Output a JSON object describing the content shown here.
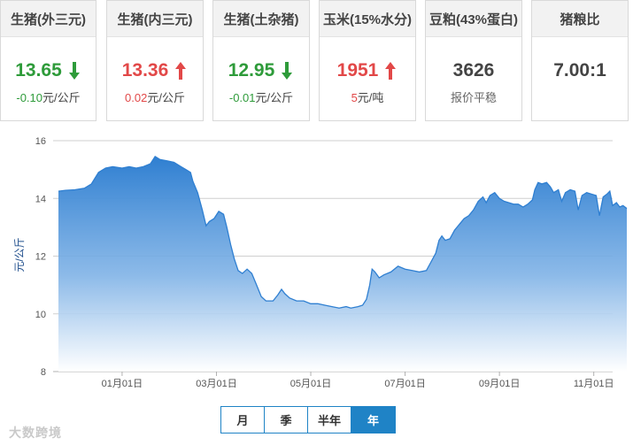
{
  "cards": [
    {
      "label": "生猪(外三元)",
      "price": "13.65",
      "direction": "down",
      "change_value": "-0.10",
      "change_unit": "元/公斤"
    },
    {
      "label": "生猪(内三元)",
      "price": "13.36",
      "direction": "up",
      "change_value": "0.02",
      "change_unit": "元/公斤"
    },
    {
      "label": "生猪(土杂猪)",
      "price": "12.95",
      "direction": "down",
      "change_value": "-0.01",
      "change_unit": "元/公斤"
    },
    {
      "label": "玉米(15%水分)",
      "price": "1951",
      "direction": "up",
      "change_value": "5",
      "change_unit": "元/吨"
    },
    {
      "label": "豆粕(43%蛋白)",
      "price": "3626",
      "direction": "none",
      "change_value": "报价平稳",
      "change_unit": ""
    },
    {
      "label": "猪粮比",
      "price": "7.00:1",
      "direction": "none",
      "change_value": "",
      "change_unit": ""
    }
  ],
  "range_buttons": [
    {
      "label": "月",
      "active": false
    },
    {
      "label": "季",
      "active": false
    },
    {
      "label": "半年",
      "active": false
    },
    {
      "label": "年",
      "active": true
    }
  ],
  "watermark": "大数跨境",
  "colors": {
    "up": "#e24848",
    "down": "#2e9b3a",
    "line": "#2f7fd1",
    "accent": "#1f83c6"
  },
  "chart_data": {
    "type": "area",
    "title": "",
    "xlabel": "",
    "ylabel": "元/公斤",
    "ylim": [
      8,
      16
    ],
    "yticks": [
      8,
      10,
      12,
      14,
      16
    ],
    "x_start_offset": -1.35,
    "x_end_offset": 10.4,
    "xtick_labels": [
      {
        "label": "01月01日",
        "month_offset": 0
      },
      {
        "label": "03月01日",
        "month_offset": 2
      },
      {
        "label": "05月01日",
        "month_offset": 4
      },
      {
        "label": "07月01日",
        "month_offset": 6
      },
      {
        "label": "09月01日",
        "month_offset": 8
      },
      {
        "label": "11月01日",
        "month_offset": 10
      }
    ],
    "series": [
      {
        "name": "",
        "points": [
          [
            -1.35,
            14.25
          ],
          [
            -1.2,
            14.28
          ],
          [
            -1.0,
            14.3
          ],
          [
            -0.8,
            14.35
          ],
          [
            -0.65,
            14.5
          ],
          [
            -0.5,
            14.9
          ],
          [
            -0.35,
            15.05
          ],
          [
            -0.2,
            15.1
          ],
          [
            0.0,
            15.05
          ],
          [
            0.15,
            15.1
          ],
          [
            0.3,
            15.05
          ],
          [
            0.45,
            15.1
          ],
          [
            0.6,
            15.2
          ],
          [
            0.7,
            15.45
          ],
          [
            0.8,
            15.35
          ],
          [
            0.95,
            15.3
          ],
          [
            1.1,
            15.25
          ],
          [
            1.25,
            15.1
          ],
          [
            1.35,
            15.0
          ],
          [
            1.45,
            14.9
          ],
          [
            1.5,
            14.6
          ],
          [
            1.6,
            14.2
          ],
          [
            1.7,
            13.6
          ],
          [
            1.78,
            13.05
          ],
          [
            1.85,
            13.2
          ],
          [
            1.95,
            13.3
          ],
          [
            2.05,
            13.55
          ],
          [
            2.15,
            13.45
          ],
          [
            2.22,
            13.0
          ],
          [
            2.3,
            12.4
          ],
          [
            2.38,
            11.9
          ],
          [
            2.46,
            11.5
          ],
          [
            2.55,
            11.4
          ],
          [
            2.65,
            11.55
          ],
          [
            2.75,
            11.4
          ],
          [
            2.85,
            11.0
          ],
          [
            2.95,
            10.6
          ],
          [
            3.05,
            10.45
          ],
          [
            3.2,
            10.45
          ],
          [
            3.3,
            10.65
          ],
          [
            3.38,
            10.85
          ],
          [
            3.45,
            10.7
          ],
          [
            3.55,
            10.55
          ],
          [
            3.7,
            10.45
          ],
          [
            3.85,
            10.45
          ],
          [
            4.0,
            10.35
          ],
          [
            4.15,
            10.35
          ],
          [
            4.3,
            10.3
          ],
          [
            4.45,
            10.25
          ],
          [
            4.6,
            10.2
          ],
          [
            4.75,
            10.25
          ],
          [
            4.85,
            10.2
          ],
          [
            5.0,
            10.25
          ],
          [
            5.1,
            10.3
          ],
          [
            5.18,
            10.5
          ],
          [
            5.25,
            11.0
          ],
          [
            5.3,
            11.55
          ],
          [
            5.36,
            11.45
          ],
          [
            5.45,
            11.25
          ],
          [
            5.55,
            11.35
          ],
          [
            5.7,
            11.45
          ],
          [
            5.85,
            11.65
          ],
          [
            6.0,
            11.55
          ],
          [
            6.15,
            11.5
          ],
          [
            6.3,
            11.45
          ],
          [
            6.45,
            11.5
          ],
          [
            6.55,
            11.8
          ],
          [
            6.65,
            12.1
          ],
          [
            6.72,
            12.55
          ],
          [
            6.78,
            12.7
          ],
          [
            6.85,
            12.55
          ],
          [
            6.95,
            12.6
          ],
          [
            7.05,
            12.9
          ],
          [
            7.15,
            13.1
          ],
          [
            7.25,
            13.3
          ],
          [
            7.35,
            13.4
          ],
          [
            7.45,
            13.6
          ],
          [
            7.55,
            13.9
          ],
          [
            7.65,
            14.05
          ],
          [
            7.72,
            13.85
          ],
          [
            7.8,
            14.1
          ],
          [
            7.9,
            14.2
          ],
          [
            8.0,
            14.0
          ],
          [
            8.1,
            13.9
          ],
          [
            8.2,
            13.85
          ],
          [
            8.3,
            13.8
          ],
          [
            8.4,
            13.8
          ],
          [
            8.5,
            13.7
          ],
          [
            8.6,
            13.8
          ],
          [
            8.7,
            13.95
          ],
          [
            8.75,
            14.3
          ],
          [
            8.82,
            14.55
          ],
          [
            8.9,
            14.5
          ],
          [
            9.0,
            14.55
          ],
          [
            9.08,
            14.4
          ],
          [
            9.15,
            14.2
          ],
          [
            9.25,
            14.3
          ],
          [
            9.32,
            13.9
          ],
          [
            9.4,
            14.2
          ],
          [
            9.5,
            14.3
          ],
          [
            9.6,
            14.25
          ],
          [
            9.67,
            13.6
          ],
          [
            9.75,
            14.1
          ],
          [
            9.85,
            14.2
          ],
          [
            9.95,
            14.15
          ],
          [
            10.05,
            14.1
          ],
          [
            10.12,
            13.4
          ],
          [
            10.2,
            14.05
          ],
          [
            10.28,
            14.15
          ],
          [
            10.34,
            14.25
          ],
          [
            10.4,
            13.75
          ],
          [
            10.48,
            13.85
          ],
          [
            10.55,
            13.7
          ],
          [
            10.62,
            13.75
          ],
          [
            10.7,
            13.65
          ]
        ]
      }
    ]
  }
}
